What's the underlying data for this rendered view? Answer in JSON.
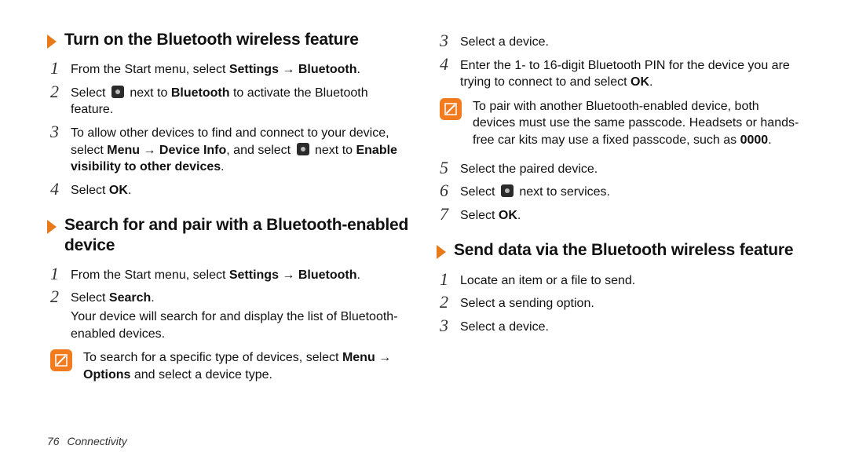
{
  "footer": {
    "page": "76",
    "section": "Connectivity"
  },
  "left": {
    "h1": "Turn on the Bluetooth wireless feature",
    "s1": {
      "n": "1",
      "a": "From the Start menu, select ",
      "b1": "Settings",
      "arr": " → ",
      "b2": "Bluetooth",
      "c": "."
    },
    "s2": {
      "n": "2",
      "a": "Select ",
      "b": " next to ",
      "b1": "Bluetooth",
      "c": " to activate the Bluetooth feature."
    },
    "s3": {
      "n": "3",
      "a": "To allow other devices to find and connect to your device, select ",
      "b1": "Menu",
      "arr": " → ",
      "b2": "Device Info",
      "c": ", and select ",
      "d": " next to ",
      "b3": "Enable visibility to other devices",
      "e": "."
    },
    "s4": {
      "n": "4",
      "a": "Select ",
      "b1": "OK",
      "c": "."
    },
    "h2": "Search for and pair with a Bluetooth-enabled device",
    "p1": {
      "n": "1",
      "a": "From the Start menu, select ",
      "b1": "Settings",
      "arr": " → ",
      "b2": "Bluetooth",
      "c": "."
    },
    "p2": {
      "n": "2",
      "a": "Select ",
      "b1": "Search",
      "c": ".",
      "sub": "Your device will search for and display the list of Bluetooth-enabled devices."
    },
    "note1": {
      "a": "To search for a specific type of devices, select ",
      "b1": "Menu",
      "arr": " → ",
      "b2": "Options",
      "c": " and select a device type."
    }
  },
  "right": {
    "r3": {
      "n": "3",
      "a": "Select a device."
    },
    "r4": {
      "n": "4",
      "a": "Enter the 1- to 16-digit Bluetooth PIN for the device you are trying to connect to and select ",
      "b1": "OK",
      "c": "."
    },
    "note2": {
      "a": "To pair with another Bluetooth-enabled device, both devices must use the same passcode. Headsets or hands-free car kits may use a fixed passcode, such as ",
      "b1": "0000",
      "c": "."
    },
    "r5": {
      "n": "5",
      "a": "Select the paired device."
    },
    "r6": {
      "n": "6",
      "a": "Select ",
      "b": " next to services."
    },
    "r7": {
      "n": "7",
      "a": "Select ",
      "b1": "OK",
      "c": "."
    },
    "h3": "Send data via the Bluetooth wireless feature",
    "q1": {
      "n": "1",
      "a": "Locate an item or a file to send."
    },
    "q2": {
      "n": "2",
      "a": "Select a sending option."
    },
    "q3": {
      "n": "3",
      "a": "Select a device."
    }
  }
}
